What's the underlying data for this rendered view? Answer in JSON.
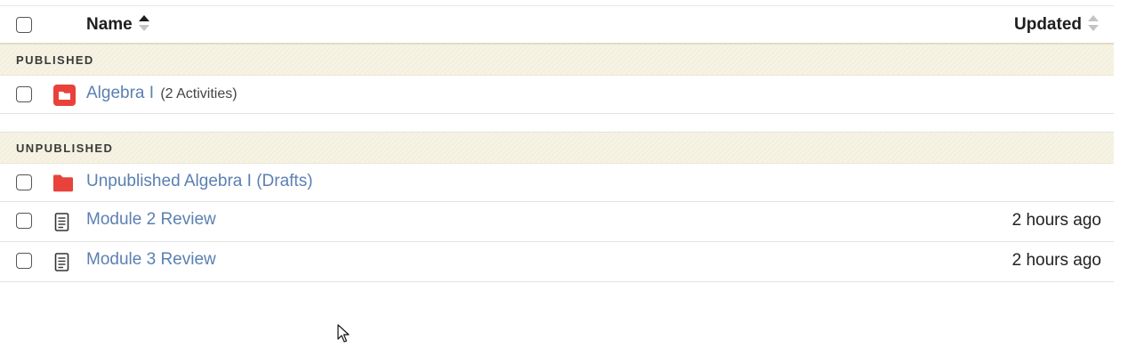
{
  "header": {
    "name_label": "Name",
    "updated_label": "Updated"
  },
  "sections": {
    "published_label": "PUBLISHED",
    "unpublished_label": "UNPUBLISHED"
  },
  "published_items": [
    {
      "name": "Algebra I",
      "meta": "(2 Activities)",
      "icon": "folder-icon-filled",
      "updated": ""
    }
  ],
  "unpublished_items": [
    {
      "name": "Unpublished Algebra I (Drafts)",
      "icon": "folder-icon",
      "updated": ""
    },
    {
      "name": "Module 2 Review",
      "icon": "document-icon",
      "updated": "2 hours ago"
    },
    {
      "name": "Module 3 Review",
      "icon": "document-icon",
      "updated": "2 hours ago"
    }
  ],
  "colors": {
    "link": "#5b80b2",
    "folder": "#e8423b",
    "section_bg": "#f7f4e4"
  }
}
